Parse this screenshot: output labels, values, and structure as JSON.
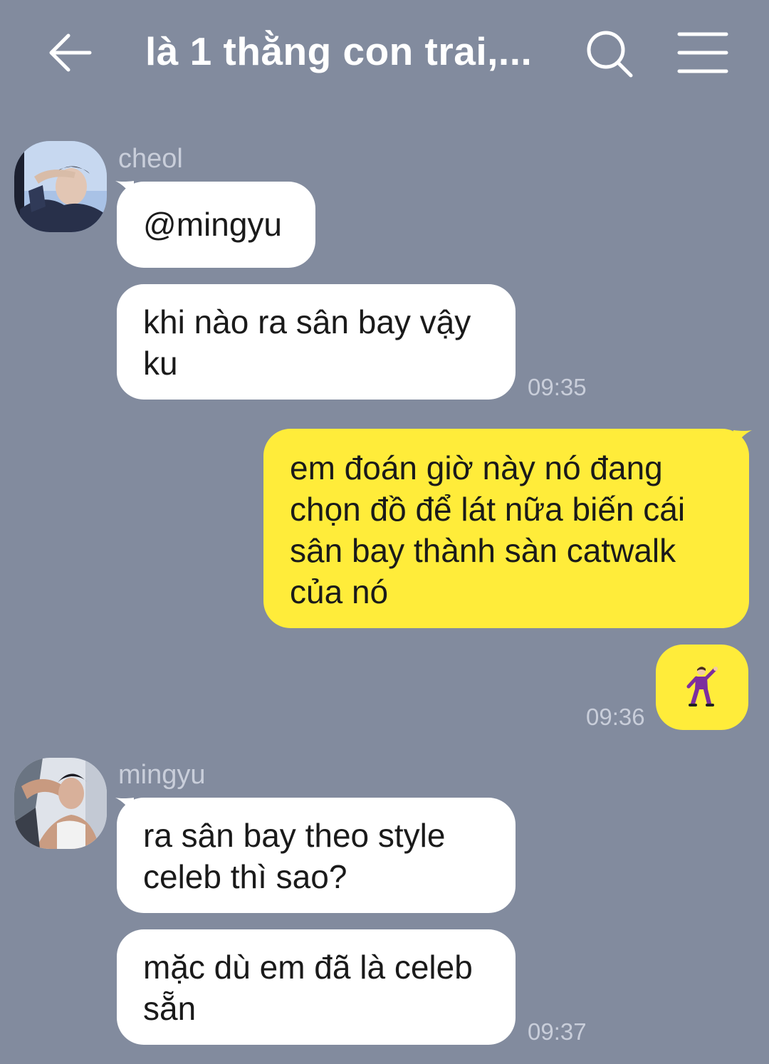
{
  "header": {
    "title": "là 1 thằng con trai,..."
  },
  "messages": [
    {
      "sender": "cheol",
      "bubbles": [
        "@mingyu",
        "khi nào ra sân bay vậy ku"
      ],
      "time": "09:35"
    },
    {
      "sender": "me",
      "bubbles": [
        "em đoán giờ này nó đang chọn đồ để lát nữa biến cái sân bay thành sàn catwalk của nó",
        "man-dancing-emoji"
      ],
      "time": "09:36"
    },
    {
      "sender": "mingyu",
      "bubbles": [
        "ra sân bay theo style celeb thì sao?",
        "mặc dù em đã là celeb sẵn"
      ],
      "time": "09:37"
    }
  ],
  "colors": {
    "background": "#828b9e",
    "incoming_bubble": "#ffffff",
    "outgoing_bubble": "#ffec3a",
    "meta_text": "#c9ceda"
  }
}
